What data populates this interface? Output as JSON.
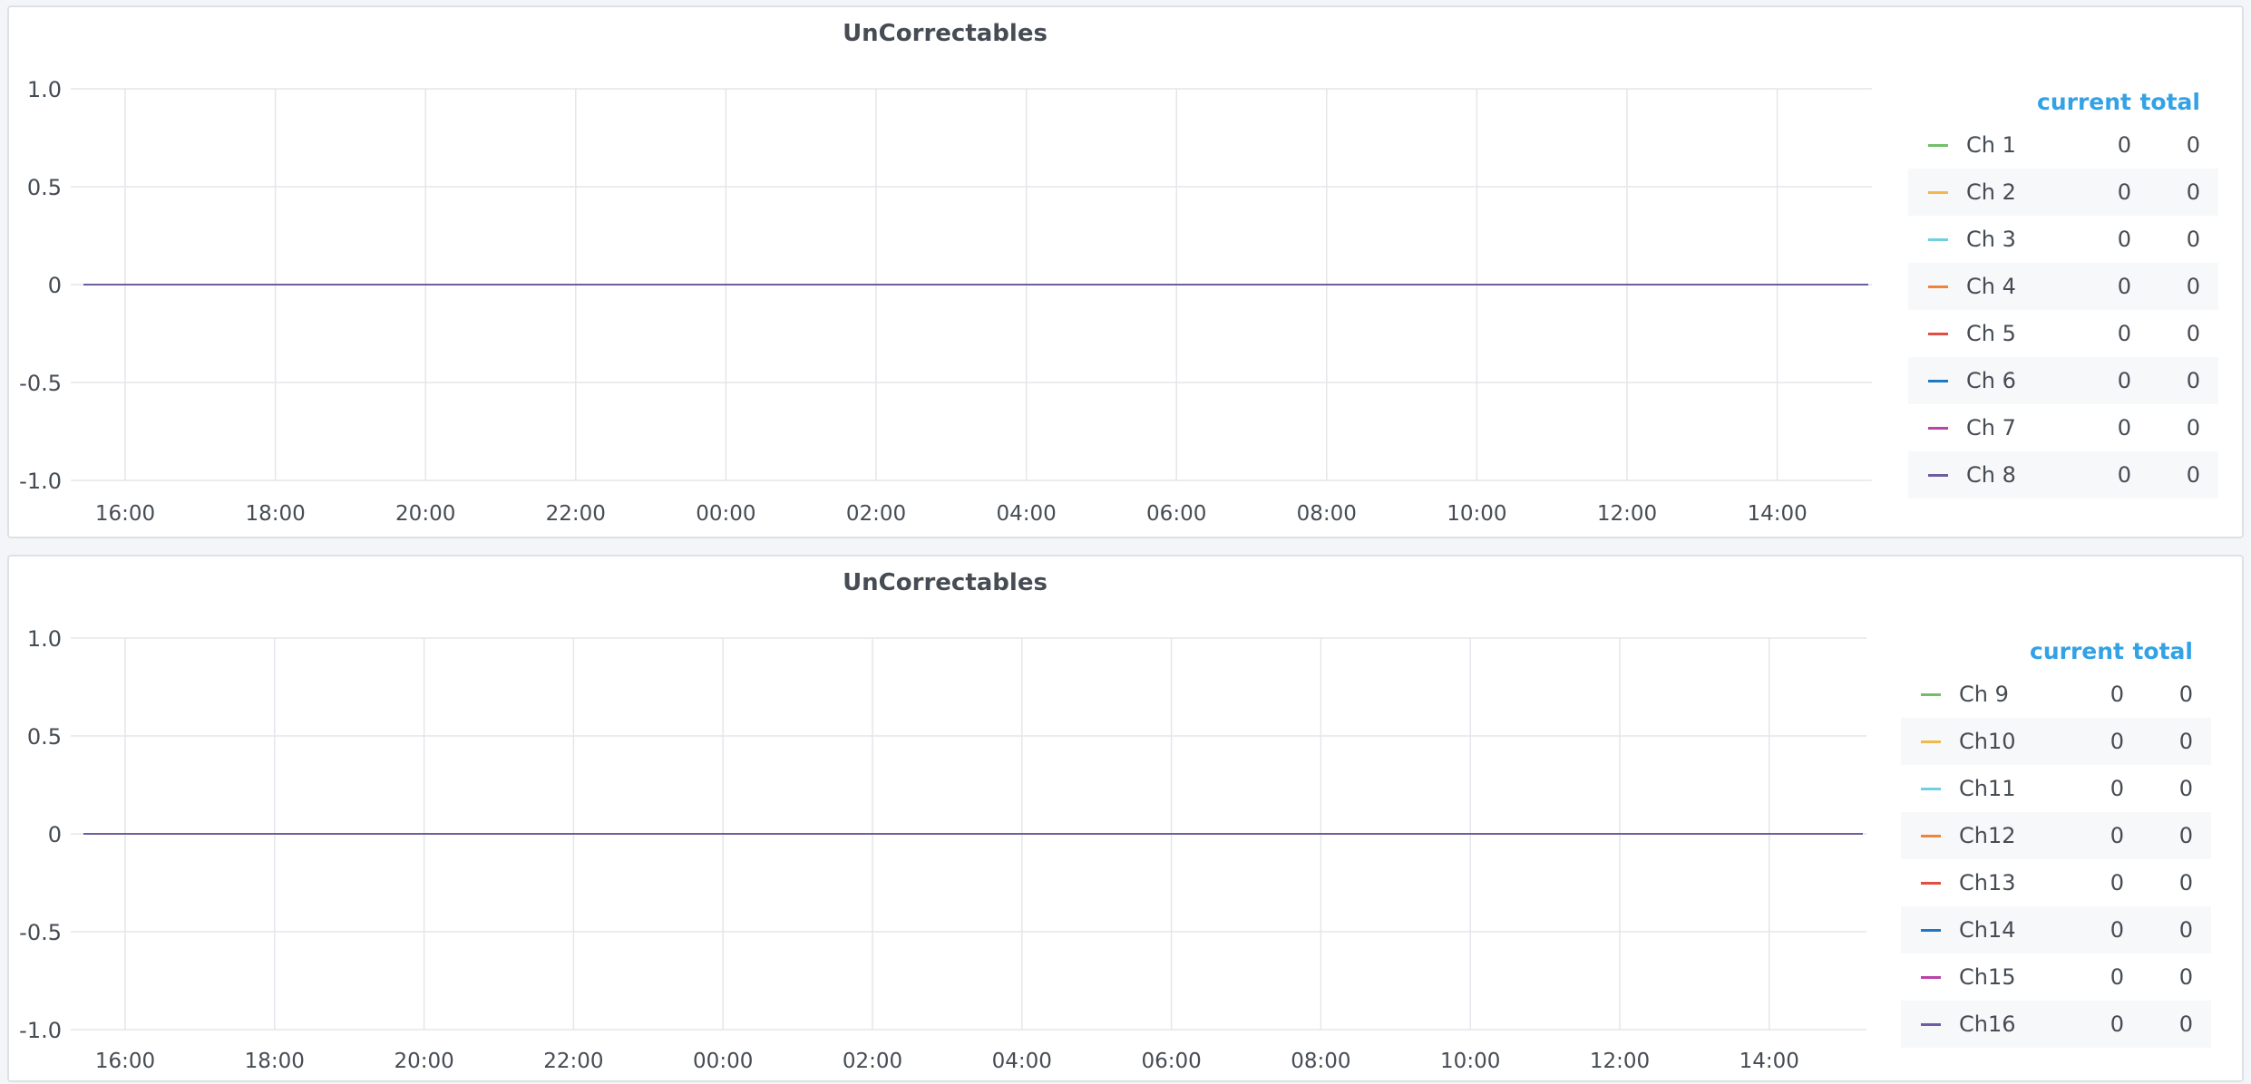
{
  "colors": {
    "grid": "#e3e6ea",
    "axis_text": "#464c54",
    "legend_header": "#33a2e5",
    "series": [
      "#73bf69",
      "#f2b84c",
      "#6ed0e0",
      "#ef843c",
      "#e24d42",
      "#1f78c1",
      "#ba43a9",
      "#705da0"
    ]
  },
  "legend_headers": {
    "current": "current",
    "total": "total"
  },
  "chart_data": [
    {
      "type": "line",
      "title": "UnCorrectables",
      "xlabel": "",
      "ylabel": "",
      "ylim": [
        -1.0,
        1.0
      ],
      "y_ticks": [
        "1.0",
        "0.5",
        "0",
        "-0.5",
        "-1.0"
      ],
      "x_ticks": [
        "16:00",
        "18:00",
        "20:00",
        "22:00",
        "00:00",
        "02:00",
        "04:00",
        "06:00",
        "08:00",
        "10:00",
        "12:00",
        "14:00"
      ],
      "grid": true,
      "legend_position": "right",
      "series": [
        {
          "name": "Ch 1",
          "values": [
            0,
            0
          ],
          "current": "0",
          "total": "0"
        },
        {
          "name": "Ch 2",
          "values": [
            0,
            0
          ],
          "current": "0",
          "total": "0"
        },
        {
          "name": "Ch 3",
          "values": [
            0,
            0
          ],
          "current": "0",
          "total": "0"
        },
        {
          "name": "Ch 4",
          "values": [
            0,
            0
          ],
          "current": "0",
          "total": "0"
        },
        {
          "name": "Ch 5",
          "values": [
            0,
            0
          ],
          "current": "0",
          "total": "0"
        },
        {
          "name": "Ch 6",
          "values": [
            0,
            0
          ],
          "current": "0",
          "total": "0"
        },
        {
          "name": "Ch 7",
          "values": [
            0,
            0
          ],
          "current": "0",
          "total": "0"
        },
        {
          "name": "Ch 8",
          "values": [
            0,
            0
          ],
          "current": "0",
          "total": "0"
        }
      ]
    },
    {
      "type": "line",
      "title": "UnCorrectables",
      "xlabel": "",
      "ylabel": "",
      "ylim": [
        -1.0,
        1.0
      ],
      "y_ticks": [
        "1.0",
        "0.5",
        "0",
        "-0.5",
        "-1.0"
      ],
      "x_ticks": [
        "16:00",
        "18:00",
        "20:00",
        "22:00",
        "00:00",
        "02:00",
        "04:00",
        "06:00",
        "08:00",
        "10:00",
        "12:00",
        "14:00"
      ],
      "grid": true,
      "legend_position": "right",
      "series": [
        {
          "name": "Ch 9",
          "values": [
            0,
            0
          ],
          "current": "0",
          "total": "0"
        },
        {
          "name": "Ch10",
          "values": [
            0,
            0
          ],
          "current": "0",
          "total": "0"
        },
        {
          "name": "Ch11",
          "values": [
            0,
            0
          ],
          "current": "0",
          "total": "0"
        },
        {
          "name": "Ch12",
          "values": [
            0,
            0
          ],
          "current": "0",
          "total": "0"
        },
        {
          "name": "Ch13",
          "values": [
            0,
            0
          ],
          "current": "0",
          "total": "0"
        },
        {
          "name": "Ch14",
          "values": [
            0,
            0
          ],
          "current": "0",
          "total": "0"
        },
        {
          "name": "Ch15",
          "values": [
            0,
            0
          ],
          "current": "0",
          "total": "0"
        },
        {
          "name": "Ch16",
          "values": [
            0,
            0
          ],
          "current": "0",
          "total": "0"
        }
      ]
    }
  ]
}
